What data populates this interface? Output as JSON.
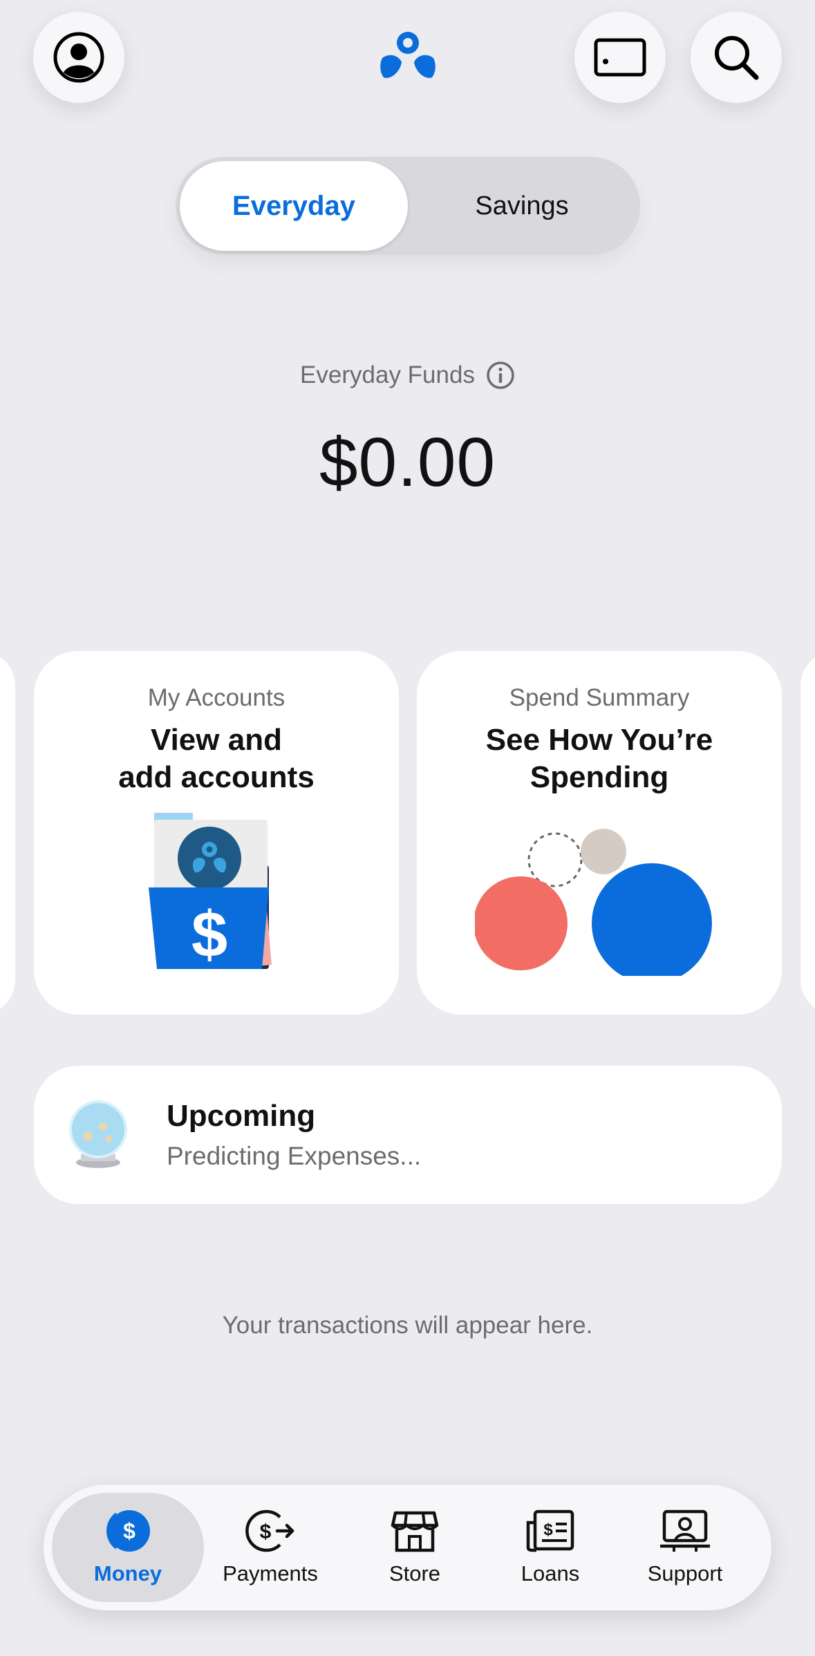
{
  "header": {
    "profile_icon": "person-circle-icon",
    "logo_icon": "bank-logo-icon",
    "card_icon": "card-icon",
    "search_icon": "search-icon"
  },
  "segments": {
    "everyday": "Everyday",
    "savings": "Savings",
    "selected": "Everyday"
  },
  "funds": {
    "label": "Everyday Funds",
    "amount": "$0.00"
  },
  "cards": [
    {
      "subtitle": "My Accounts",
      "title_line1": "View and",
      "title_line2": "add accounts"
    },
    {
      "subtitle": "Spend Summary",
      "title_line1": "See How You’re",
      "title_line2": "Spending"
    }
  ],
  "upcoming": {
    "title": "Upcoming",
    "subtitle": "Predicting Expenses..."
  },
  "empty_state": "Your transactions will appear here.",
  "tabbar": {
    "tabs": [
      {
        "label": "Money",
        "icon": "money-icon",
        "selected": true
      },
      {
        "label": "Payments",
        "icon": "payments-icon"
      },
      {
        "label": "Store",
        "icon": "store-icon"
      },
      {
        "label": "Loans",
        "icon": "loans-icon"
      },
      {
        "label": "Support",
        "icon": "support-icon"
      }
    ]
  },
  "colors": {
    "accent": "#0a6ddb",
    "background": "#ebebf0",
    "coral": "#f26d64",
    "beige": "#d6cbc3"
  }
}
